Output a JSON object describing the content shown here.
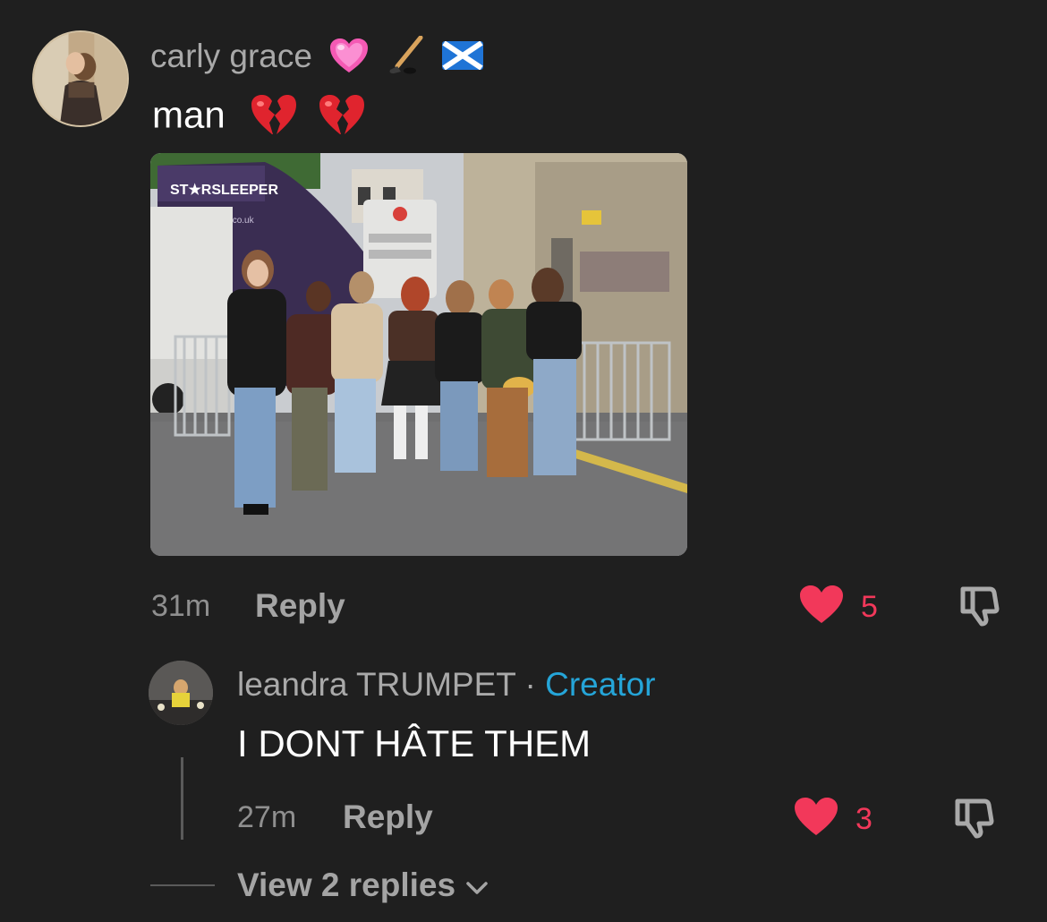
{
  "comment": {
    "username": "carly grace",
    "name_emojis": [
      "pink-heart",
      "hockey-stick",
      "scotland-flag"
    ],
    "text": "man",
    "text_emojis": [
      "broken-heart",
      "broken-heart"
    ],
    "photo": {
      "bus_brand": "ST★RSLEEPER",
      "bus_url": "starsleeper.co.uk"
    },
    "timestamp": "31m",
    "reply_label": "Reply",
    "likes": "5"
  },
  "reply": {
    "username": "leandra TRUMPET",
    "separator": "·",
    "badge": "Creator",
    "text": "I DONT HÂTE THEM",
    "timestamp": "27m",
    "reply_label": "Reply",
    "likes": "3"
  },
  "thread": {
    "view_replies": "View 2 replies"
  },
  "colors": {
    "background": "#1f1f1f",
    "like": "#f2385a",
    "creator": "#25a5d8",
    "muted": "#a4a4a4"
  }
}
